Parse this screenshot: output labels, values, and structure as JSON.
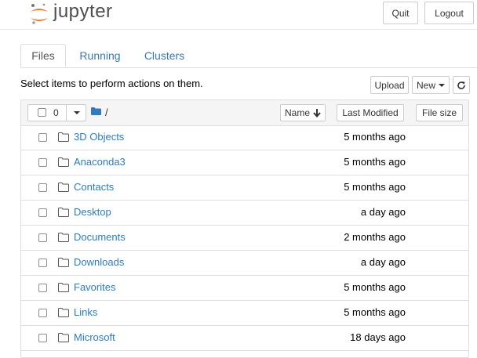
{
  "app": {
    "logo_text": "jupyter",
    "quit_label": "Quit",
    "logout_label": "Logout"
  },
  "tabs": [
    {
      "label": "Files",
      "active": true
    },
    {
      "label": "Running",
      "active": false
    },
    {
      "label": "Clusters",
      "active": false
    }
  ],
  "toolbar": {
    "hint": "Select items to perform actions on them.",
    "upload_label": "Upload",
    "new_label": "New",
    "refresh_icon": "refresh-icon"
  },
  "list_header": {
    "selected_count": "0",
    "path": "/",
    "name_label": "Name",
    "last_modified_label": "Last Modified",
    "file_size_label": "File size"
  },
  "files": [
    {
      "name": "3D Objects",
      "modified": "5 months ago"
    },
    {
      "name": "Anaconda3",
      "modified": "5 months ago"
    },
    {
      "name": "Contacts",
      "modified": "5 months ago"
    },
    {
      "name": "Desktop",
      "modified": "a day ago"
    },
    {
      "name": "Documents",
      "modified": "2 months ago"
    },
    {
      "name": "Downloads",
      "modified": "a day ago"
    },
    {
      "name": "Favorites",
      "modified": "5 months ago"
    },
    {
      "name": "Links",
      "modified": "5 months ago"
    },
    {
      "name": "Microsoft",
      "modified": "18 days ago"
    }
  ],
  "colors": {
    "link": "#337ab7",
    "logo_orange": "#f37726",
    "folder_blue": "#337ab7"
  }
}
